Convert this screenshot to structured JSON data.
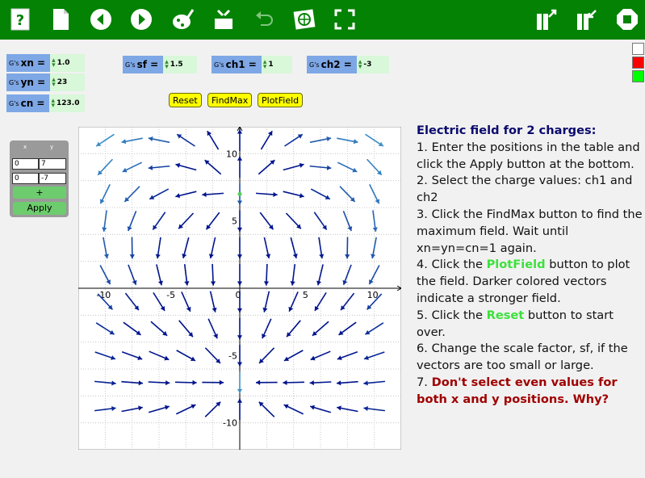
{
  "toolbar": {
    "buttons": [
      {
        "name": "help-icon",
        "x": 8
      },
      {
        "name": "new-page-icon",
        "x": 58
      },
      {
        "name": "back-icon",
        "x": 108
      },
      {
        "name": "forward-icon",
        "x": 158
      },
      {
        "name": "paint-icon",
        "x": 210
      },
      {
        "name": "tools-box-icon",
        "x": 260
      },
      {
        "name": "undo-icon",
        "x": 310
      },
      {
        "name": "globe-icon",
        "x": 360
      },
      {
        "name": "fullscreen-icon",
        "x": 410
      },
      {
        "name": "export-icon",
        "x": 660
      },
      {
        "name": "import-icon",
        "x": 710
      },
      {
        "name": "stop-icon",
        "x": 760
      }
    ]
  },
  "side_colors": [
    "#ffffff",
    "#ff0000",
    "#00ff00"
  ],
  "sliders": {
    "prefix": "G's",
    "xn": {
      "name": "xn =",
      "value": "1.0"
    },
    "yn": {
      "name": "yn =",
      "value": "23"
    },
    "cn": {
      "name": "cn =",
      "value": "123.0"
    },
    "sf": {
      "name": "sf =",
      "value": "1.5"
    },
    "ch1": {
      "name": "ch1 =",
      "value": "1"
    },
    "ch2": {
      "name": "ch2 =",
      "value": "-3"
    }
  },
  "buttons": {
    "reset": "Reset",
    "findmax": "FindMax",
    "plotfield": "PlotField"
  },
  "table": {
    "headers": [
      "x",
      "y"
    ],
    "rows": [
      [
        "0",
        "7"
      ],
      [
        "0",
        "-7"
      ]
    ],
    "add_label": "+",
    "apply_label": "Apply"
  },
  "chart_data": {
    "type": "scatter",
    "title": "",
    "xlim": [
      -12,
      12
    ],
    "ylim": [
      -12,
      12
    ],
    "x_ticks": [
      "-10",
      "-5",
      "0",
      "5",
      "10"
    ],
    "y_ticks": [
      "10",
      "5",
      "-5",
      "-10"
    ],
    "grid": true,
    "charges": [
      {
        "x": 0,
        "y": 7,
        "q": 1
      },
      {
        "x": 0,
        "y": -7,
        "q": -3
      }
    ],
    "marker_point": {
      "x": 0,
      "y": 7,
      "color": "#55cc55"
    }
  },
  "instructions": {
    "title": "Electric field for 2 charges:",
    "s1": "1. Enter the positions in the table and click the Apply button at the bottom.",
    "s2": "2. Select the charge values: ch1 and ch2",
    "s3": "3. Click the FindMax button to find the maximum field. Wait until xn=yn=cn=1 again.",
    "s4a": "4. Click the ",
    "s4b": "PlotField",
    "s4c": " button to plot the field. Darker colored vectors indicate a stronger field.",
    "s5a": "5. Click the ",
    "s5b": "Reset",
    "s5c": " button to start over.",
    "s6": "6. Change the scale factor, sf, if the vectors are too small or large.",
    "s7a": "7. ",
    "s7b": "Don't select even values for both x and y positions. Why?"
  }
}
